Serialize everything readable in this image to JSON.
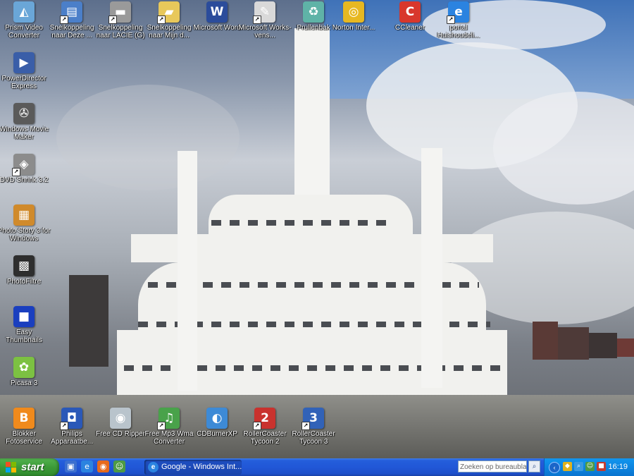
{
  "desktop_icons": [
    {
      "name": "prism-video-converter",
      "label": "Prism Video Converter",
      "icon": "prism-icon",
      "color": "#6aa6d8",
      "shortcut": false
    },
    {
      "name": "shortcut-deze",
      "label": "Snelkoppeling naar Deze ...",
      "icon": "computer-icon",
      "color": "#4b7fc9",
      "shortcut": true
    },
    {
      "name": "shortcut-lacie",
      "label": "Snelkoppeling naar LACIE (G)",
      "icon": "drive-icon",
      "color": "#9a9a9a",
      "shortcut": true
    },
    {
      "name": "shortcut-mijn",
      "label": "Snelkoppeling naar Mijn d...",
      "icon": "folder-icon",
      "color": "#e8c85a",
      "shortcut": true
    },
    {
      "name": "microsoft-word",
      "label": "Microsoft Word",
      "icon": "word-icon",
      "color": "#2b4c9b",
      "shortcut": false
    },
    {
      "name": "microsoft-works",
      "label": "Microsoft Works-vens...",
      "icon": "works-icon",
      "color": "#d9d9d9",
      "shortcut": true
    },
    {
      "name": "prullenbak",
      "label": "Prullenbak",
      "icon": "recycle-bin-icon",
      "color": "#5fb3a7",
      "shortcut": false
    },
    {
      "name": "norton-internet",
      "label": "Norton Inter...",
      "icon": "norton-icon",
      "color": "#e7b821",
      "shortcut": false
    },
    {
      "name": "ccleaner",
      "label": "CCleaner",
      "icon": "ccleaner-icon",
      "color": "#d8372c",
      "shortcut": false
    },
    {
      "name": "portal-huishoudelijk",
      "label": "portal Huishoudeli...",
      "icon": "ie-icon",
      "color": "#2b83e0",
      "shortcut": true
    },
    {
      "name": "powerdirector",
      "label": "PowerDirector Express",
      "icon": "powerdirector-icon",
      "color": "#3a5ea8",
      "shortcut": false
    },
    {
      "name": "windows-movie-maker",
      "label": "Windows Movie Maker",
      "icon": "movie-maker-icon",
      "color": "#5a5a5a",
      "shortcut": false
    },
    {
      "name": "dvd-shrink",
      "label": "DVD Shrink 3.2",
      "icon": "dvd-shrink-icon",
      "color": "#8c8c8c",
      "shortcut": true
    },
    {
      "name": "photo-story",
      "label": "Photo Story 3 for Windows",
      "icon": "photo-story-icon",
      "color": "#d08a2b",
      "shortcut": false
    },
    {
      "name": "photofiltre",
      "label": "PhotoFiltre",
      "icon": "photofiltre-icon",
      "color": "#2e2e2e",
      "shortcut": false
    },
    {
      "name": "easy-thumbnails",
      "label": "Easy Thumbnails",
      "icon": "easy-thumbnails-icon",
      "color": "#1a3fbf",
      "shortcut": false
    },
    {
      "name": "picasa",
      "label": "Picasa 3",
      "icon": "picasa-icon",
      "color": "#7cc142",
      "shortcut": false
    },
    {
      "name": "blokker-fotoservice",
      "label": "Blokker Fotoservice",
      "icon": "blokker-icon",
      "color": "#f08a1c",
      "shortcut": false
    },
    {
      "name": "philips-apparaat",
      "label": "Philips Apparaatbe...",
      "icon": "philips-icon",
      "color": "#2a58b8",
      "shortcut": true
    },
    {
      "name": "free-cd-ripper",
      "label": "Free CD Ripper",
      "icon": "cd-icon",
      "color": "#b9c4cc",
      "shortcut": false
    },
    {
      "name": "free-mp3-wma",
      "label": "Free Mp3 Wma Converter",
      "icon": "converter-icon",
      "color": "#49a24a",
      "shortcut": true
    },
    {
      "name": "cdburnerxp",
      "label": "CDBurnerXP",
      "icon": "cdburner-icon",
      "color": "#3d8ad6",
      "shortcut": false
    },
    {
      "name": "rollercoaster-2",
      "label": "RollerCoaster Tycoon 2",
      "icon": "rollercoaster-icon",
      "color": "#c9322e",
      "shortcut": true
    },
    {
      "name": "rollercoaster-3",
      "label": "RollerCoaster Tycoon 3",
      "icon": "rollercoaster3-icon",
      "color": "#3162b8",
      "shortcut": true
    }
  ],
  "taskbar": {
    "start_label": "start",
    "quick_launch": [
      {
        "name": "show-desktop",
        "icon": "desktop-icon",
        "color": "#3b6fcf",
        "glyph": "▣"
      },
      {
        "name": "internet-explorer",
        "icon": "ie-icon",
        "color": "#2b83e0",
        "glyph": "e"
      },
      {
        "name": "firefox",
        "icon": "firefox-icon",
        "color": "#e66a1c",
        "glyph": "◉"
      },
      {
        "name": "messenger",
        "icon": "messenger-icon",
        "color": "#4d9a45",
        "glyph": "☺"
      }
    ],
    "task_button": "Google - Windows Int...",
    "search_placeholder": "Zoeken op bureaublad",
    "tray_icons": [
      {
        "name": "norton-tray",
        "icon": "shield-icon",
        "color": "#e0b21d",
        "glyph": "◆"
      },
      {
        "name": "network-tray",
        "icon": "network-icon",
        "color": "#3b9ae1",
        "glyph": "⌕"
      },
      {
        "name": "messenger-tray",
        "icon": "messenger-icon",
        "color": "#4d9a45",
        "glyph": "☺"
      },
      {
        "name": "update-tray",
        "icon": "update-icon",
        "color": "#c43a2f",
        "glyph": "■"
      }
    ],
    "clock": "16:19"
  }
}
